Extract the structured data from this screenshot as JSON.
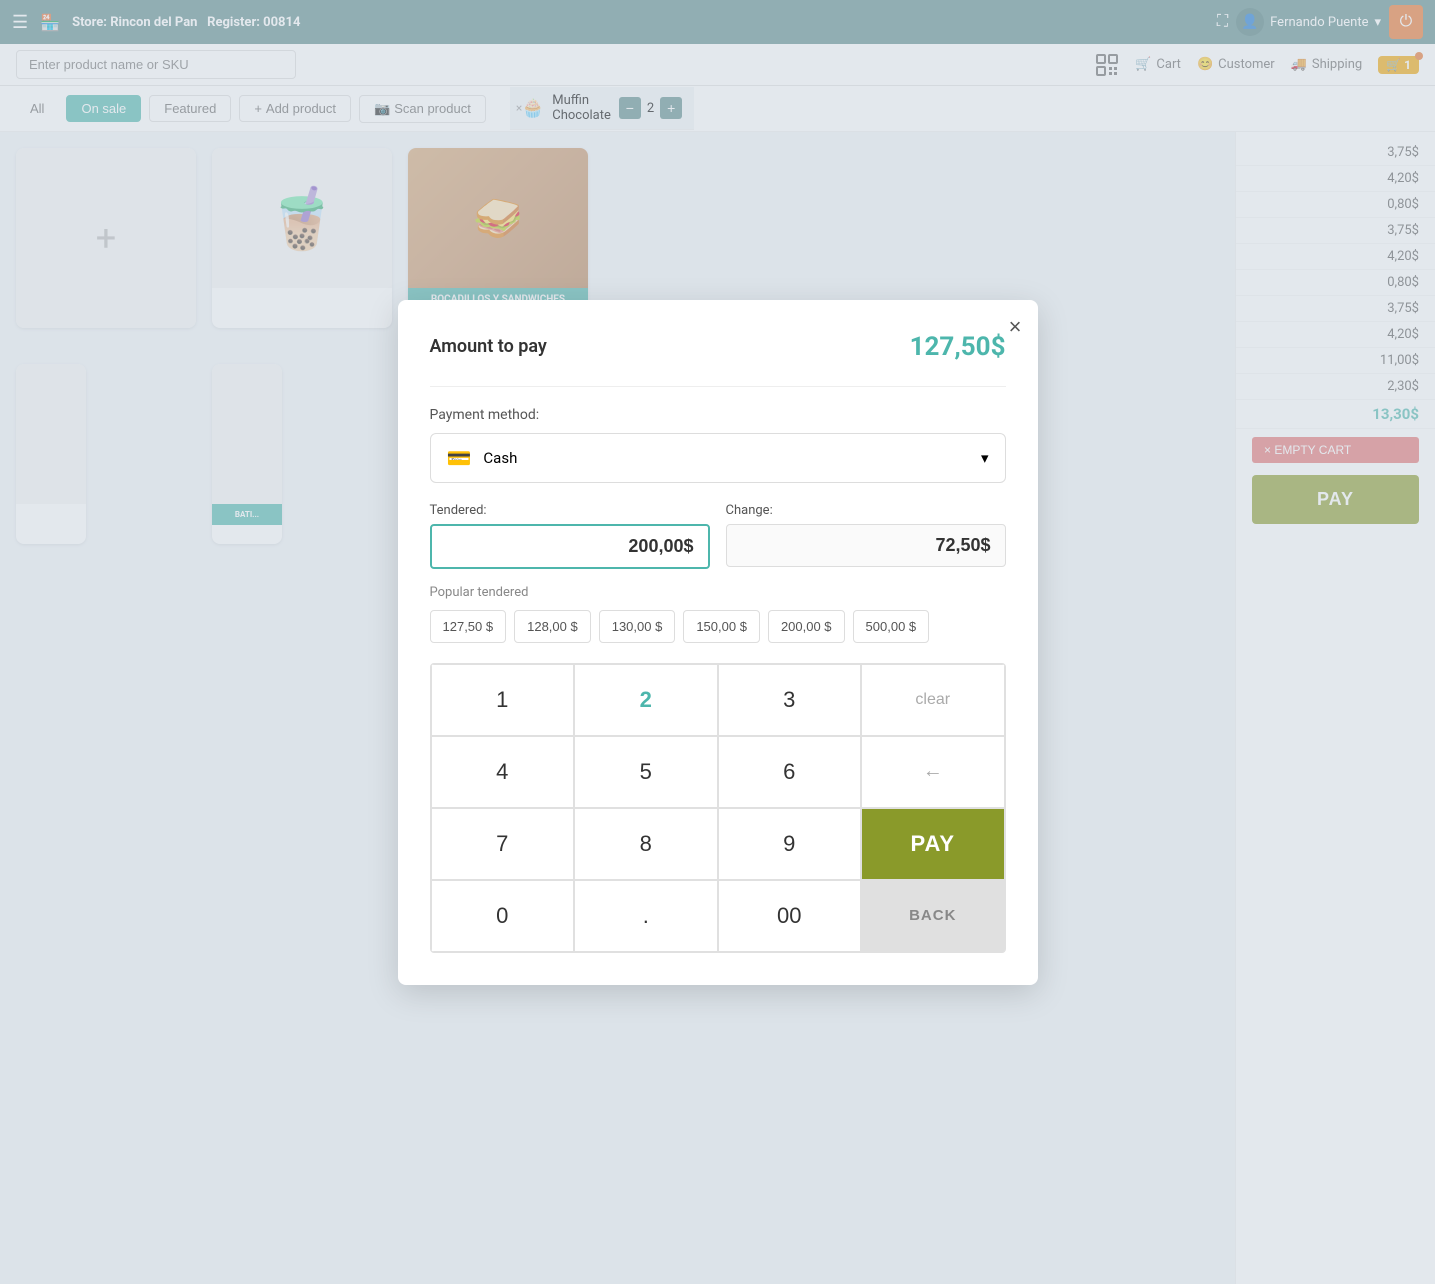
{
  "topNav": {
    "hamburger": "☰",
    "storeIcon": "🏪",
    "storeLabel": "Store:",
    "storeName": "Rincon del Pan",
    "registerLabel": "Register:",
    "registerNumber": "00814",
    "fullscreenIcon": "⛶",
    "userName": "Fernando Puente",
    "userIcon": "👤",
    "powerIcon": "⏻"
  },
  "searchBar": {
    "placeholder": "Enter product name or SKU",
    "cartLabel": "Cart",
    "customerLabel": "Customer",
    "shippingLabel": "Shipping",
    "cartCount": "1"
  },
  "filterBar": {
    "allLabel": "All",
    "onSaleLabel": "On sale",
    "featuredLabel": "Featured",
    "addProductLabel": "+ Add product",
    "scanLabel": "📷 Scan product"
  },
  "products": [
    {
      "id": "add",
      "type": "add",
      "icon": "+"
    },
    {
      "id": "drink",
      "type": "drink",
      "icon": "🧋"
    },
    {
      "id": "sandwich",
      "type": "sandwich",
      "label": "BOCADILLOS Y SANDWICHES"
    },
    {
      "id": "partial1",
      "type": "partial"
    },
    {
      "id": "partial2",
      "type": "partial",
      "label": "BATI..."
    }
  ],
  "muffinBar": {
    "close": "×",
    "icon": "🧁",
    "name": "Muffin",
    "sub": "Chocolate",
    "minusBtn": "−",
    "qty": "2",
    "plusBtn": "+"
  },
  "priceList": [
    {
      "value": "3,75$"
    },
    {
      "value": "4,20$"
    },
    {
      "value": "0,80$"
    },
    {
      "value": "3,75$"
    },
    {
      "value": "4,20$"
    },
    {
      "value": "0,80$"
    },
    {
      "value": "3,75$"
    },
    {
      "value": "4,20$"
    },
    {
      "value": "11,00$"
    },
    {
      "value": "2,30$"
    }
  ],
  "totalPrice": "13,30$",
  "emptyCarthLabel": "× EMPTY CART",
  "payBtnLabel": "PAY",
  "modal": {
    "closeBtn": "×",
    "amountLabel": "Amount to pay",
    "amountValue": "127,50$",
    "paymentMethodLabel": "Payment method:",
    "paymentMethod": "Cash",
    "cashIcon": "💳",
    "chevronIcon": "▾",
    "tenderedLabel": "Tendered:",
    "tenderedValue": "200,00$",
    "changeLabel": "Change:",
    "changeValue": "72,50$",
    "popularLabel": "Popular tendered",
    "popularOptions": [
      "127,50 $",
      "128,00 $",
      "130,00 $",
      "150,00 $",
      "200,00 $",
      "500,00 $"
    ],
    "numpad": {
      "keys": [
        "1",
        "2",
        "3",
        "clear",
        "4",
        "5",
        "6",
        "←",
        "7",
        "8",
        "9",
        "PAY",
        "0",
        ".",
        "00",
        "BACK"
      ]
    },
    "payBtnLabel": "PAY",
    "backBtnLabel": "BACK",
    "clearBtnLabel": "clear",
    "backspaceBtnLabel": "←"
  }
}
